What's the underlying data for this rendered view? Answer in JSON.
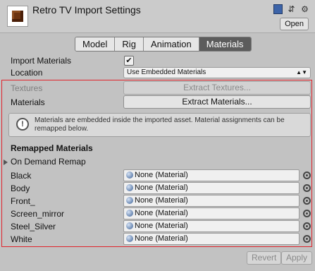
{
  "header": {
    "title": "Retro TV Import Settings",
    "open_label": "Open",
    "icons": [
      "book-icon",
      "sliders-icon",
      "gear-icon"
    ]
  },
  "tabs": [
    {
      "label": "Model",
      "active": false
    },
    {
      "label": "Rig",
      "active": false
    },
    {
      "label": "Animation",
      "active": false
    },
    {
      "label": "Materials",
      "active": true
    }
  ],
  "import_materials": {
    "label": "Import Materials",
    "checked": true,
    "check_glyph": "✔"
  },
  "location": {
    "label": "Location",
    "value": "Use Embedded Materials"
  },
  "textures": {
    "label": "Textures",
    "button": "Extract Textures..."
  },
  "materials": {
    "label": "Materials",
    "button": "Extract Materials..."
  },
  "help": {
    "text": "Materials are embedded inside the imported asset. Material assignments can be remapped below."
  },
  "remapped": {
    "title": "Remapped Materials",
    "foldout": "On Demand Remap",
    "rows": [
      {
        "name": "Black",
        "value": "None (Material)"
      },
      {
        "name": "Body",
        "value": "None (Material)"
      },
      {
        "name": "Front_",
        "value": "None (Material)"
      },
      {
        "name": "Screen_mirror",
        "value": "None (Material)"
      },
      {
        "name": "Steel_Silver",
        "value": "None (Material)"
      },
      {
        "name": "White",
        "value": "None (Material)"
      }
    ]
  },
  "footer": {
    "revert": "Revert",
    "apply": "Apply"
  },
  "colors": {
    "highlight_border": "#e0242c",
    "active_tab": "#5c5c5c"
  }
}
